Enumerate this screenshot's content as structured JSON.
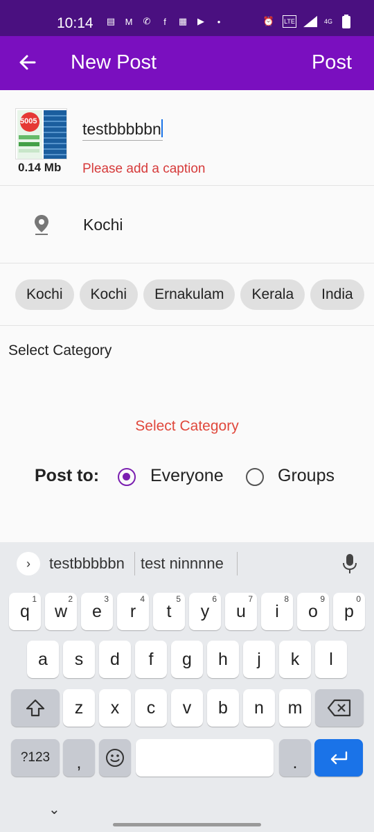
{
  "status_bar": {
    "time": "10:14",
    "network": "4G"
  },
  "app_bar": {
    "title": "New Post",
    "action": "Post"
  },
  "media": {
    "size": "0.14 Mb",
    "thumb_number": "5005"
  },
  "caption": {
    "value": "testbbbbbn",
    "error": "Please add a caption"
  },
  "location": {
    "value": "Kochi"
  },
  "location_chips": [
    "Kochi",
    "Kochi",
    "Ernakulam",
    "Kerala",
    "India"
  ],
  "category": {
    "label": "Select Category",
    "prompt": "Select Category"
  },
  "post_to": {
    "label": "Post to:",
    "options": [
      "Everyone",
      "Groups"
    ],
    "selected": "Everyone"
  },
  "keyboard": {
    "suggestions": [
      "testbbbbbn",
      "test ninnnne"
    ],
    "row1": [
      "q",
      "w",
      "e",
      "r",
      "t",
      "y",
      "u",
      "i",
      "o",
      "p"
    ],
    "row1_hints": [
      "1",
      "2",
      "3",
      "4",
      "5",
      "6",
      "7",
      "8",
      "9",
      "0"
    ],
    "row2": [
      "a",
      "s",
      "d",
      "f",
      "g",
      "h",
      "j",
      "k",
      "l"
    ],
    "row3": [
      "z",
      "x",
      "c",
      "v",
      "b",
      "n",
      "m"
    ],
    "symbols_key": "?123",
    "comma_key": ",",
    "period_key": "."
  },
  "colors": {
    "appbar": "#7a0fbf",
    "statusbar": "#4a1080",
    "error": "#d63a3a",
    "accent": "#7a1fb0",
    "enter": "#1a73e8"
  }
}
